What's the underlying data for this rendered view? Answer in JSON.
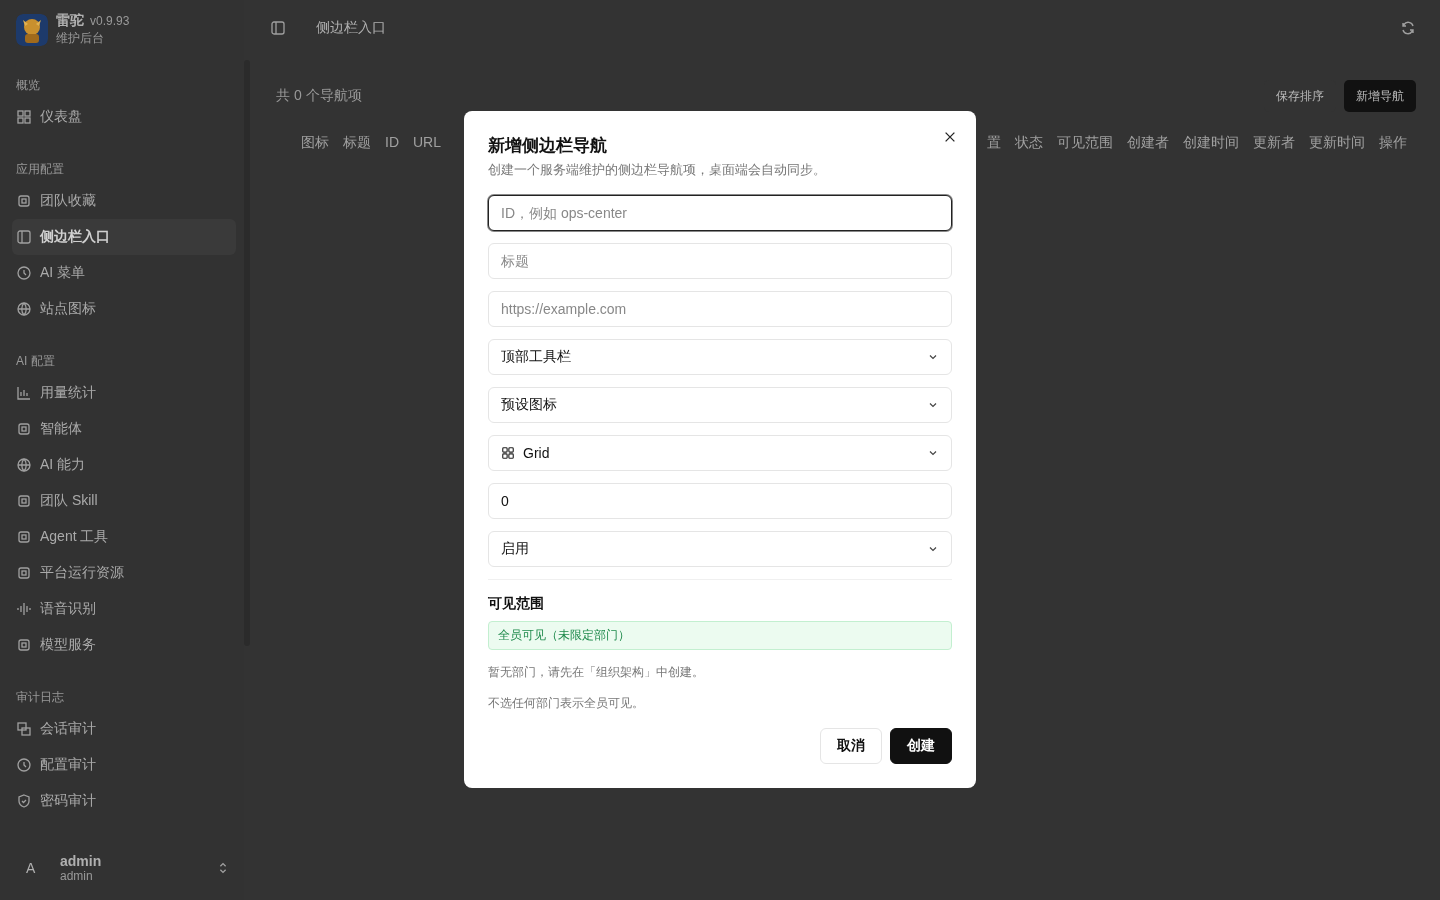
{
  "app": {
    "name": "雷驼",
    "version": "v0.9.93",
    "subtitle": "维护后台"
  },
  "sidebar": {
    "sections": [
      {
        "title": "概览",
        "items": [
          {
            "label": "仪表盘",
            "selected": false
          }
        ]
      },
      {
        "title": "应用配置",
        "items": [
          {
            "label": "团队收藏",
            "selected": false
          },
          {
            "label": "侧边栏入口",
            "selected": true
          },
          {
            "label": "AI 菜单",
            "selected": false
          },
          {
            "label": "站点图标",
            "selected": false
          }
        ]
      },
      {
        "title": "AI 配置",
        "items": [
          {
            "label": "用量统计",
            "selected": false
          },
          {
            "label": "智能体",
            "selected": false
          },
          {
            "label": "AI 能力",
            "selected": false
          },
          {
            "label": "团队 Skill",
            "selected": false
          },
          {
            "label": "Agent 工具",
            "selected": false
          },
          {
            "label": "平台运行资源",
            "selected": false
          },
          {
            "label": "语音识别",
            "selected": false
          },
          {
            "label": "模型服务",
            "selected": false
          }
        ]
      },
      {
        "title": "审计日志",
        "items": [
          {
            "label": "会话审计",
            "selected": false
          },
          {
            "label": "配置审计",
            "selected": false
          },
          {
            "label": "密码审计",
            "selected": false
          }
        ]
      }
    ],
    "user": {
      "avatar": "A",
      "name": "admin",
      "role": "admin"
    }
  },
  "header": {
    "title": "侧边栏入口"
  },
  "toolbar": {
    "count": "共 0 个导航项",
    "buttons": [
      {
        "label": "保存排序",
        "kind": "secondary"
      },
      {
        "label": "新增导航",
        "kind": "primary"
      }
    ]
  },
  "table": {
    "columns_left": [
      "图标",
      "标题",
      "ID",
      "URL"
    ],
    "columns_right": [
      "置",
      "状态",
      "可见范围",
      "创建者",
      "创建时间",
      "更新者",
      "更新时间",
      "操作"
    ]
  },
  "dialog": {
    "title": "新增侧边栏导航",
    "description": "创建一个服务端维护的侧边栏导航项，桌面端会自动同步。",
    "fields": [
      {
        "kind": "input",
        "placeholder": "ID，例如 ops-center",
        "focused": true
      },
      {
        "kind": "input",
        "placeholder": "标题",
        "focused": false
      },
      {
        "kind": "input",
        "placeholder": "https://example.com",
        "focused": false
      },
      {
        "kind": "select",
        "value": "顶部工具栏",
        "icon": false
      },
      {
        "kind": "select",
        "value": "预设图标",
        "icon": false
      },
      {
        "kind": "select",
        "value": "Grid",
        "icon": true
      },
      {
        "kind": "input",
        "value": "0",
        "focused": false
      },
      {
        "kind": "select",
        "value": "启用",
        "icon": false
      }
    ],
    "visibility": {
      "title": "可见范围",
      "badge": "全员可见（未限定部门）",
      "notes": [
        "暂无部门，请先在「组织架构」中创建。",
        "不选任何部门表示全员可见。"
      ]
    },
    "buttons": [
      {
        "label": "取消",
        "kind": "secondary"
      },
      {
        "label": "创建",
        "kind": "primary"
      }
    ]
  }
}
